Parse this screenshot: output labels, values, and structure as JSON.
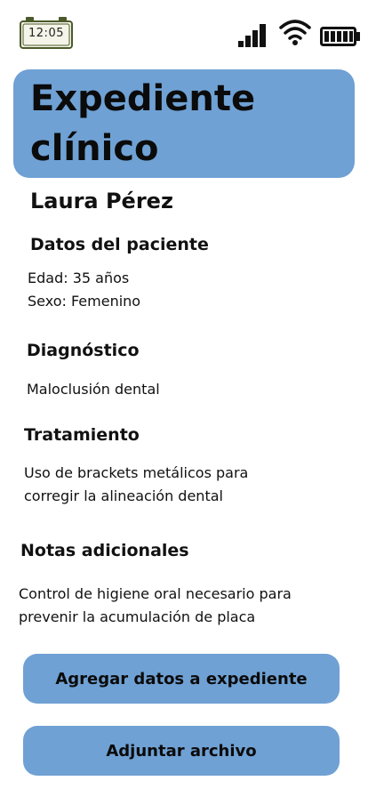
{
  "status_bar": {
    "time": "12:05",
    "icons": [
      "clock-icon",
      "signal-icon",
      "wifi-icon",
      "battery-icon"
    ]
  },
  "header": {
    "title_line1": "Expediente",
    "title_line2": "clínico"
  },
  "patient": {
    "name": "Laura Pérez"
  },
  "patient_data": {
    "heading": "Datos del paciente",
    "age": "Edad: 35 años",
    "sex": "Sexo: Femenino"
  },
  "diagnosis": {
    "heading": "Diagnóstico",
    "text": "Maloclusión dental"
  },
  "treatment": {
    "heading": "Tratamiento",
    "line1": "Uso de brackets metálicos para",
    "line2": "corregir la alineación dental"
  },
  "notes": {
    "heading": "Notas adicionales",
    "line1": "Control de higiene oral necesario para",
    "line2": "prevenir la acumulación de placa"
  },
  "actions": {
    "add_label": "Agregar datos a expediente",
    "attach_label": "Adjuntar archivo"
  },
  "colors": {
    "accent": "#6fa1d4",
    "text": "#111111",
    "background": "#ffffff"
  }
}
